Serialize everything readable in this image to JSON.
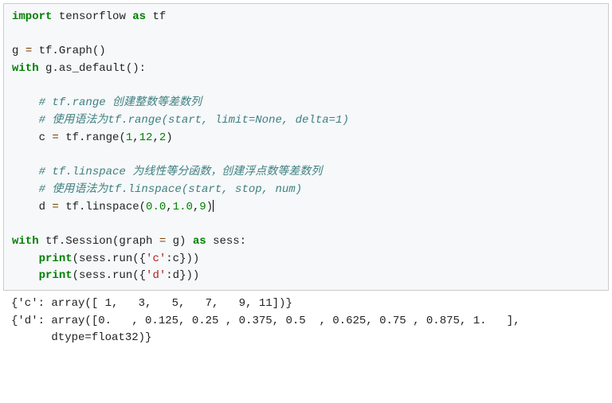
{
  "code": {
    "l1_kw_import": "import",
    "l1_sp1": " ",
    "l1_mod": "tensorflow",
    "l1_sp2": " ",
    "l1_kw_as": "as",
    "l1_sp3": " ",
    "l1_alias": "tf",
    "l2_blank": " ",
    "l3_g": "g ",
    "l3_eq": "=",
    "l3_rest": " tf.Graph()",
    "l4_with": "with",
    "l4_rest": " g.as_default():",
    "l5_blank": " ",
    "l6_indent": "    ",
    "l6_cmt": "# tf.range 创建整数等差数列",
    "l7_indent": "    ",
    "l7_cmt": "# 使用语法为tf.range(start, limit=None, delta=1)",
    "l8_indent": "    ",
    "l8_lhs": "c ",
    "l8_eq": "=",
    "l8_mid": " tf.range(",
    "l8_n1": "1",
    "l8_c1": ",",
    "l8_n2": "12",
    "l8_c2": ",",
    "l8_n3": "2",
    "l8_close": ")",
    "l9_blank": " ",
    "l10_indent": "    ",
    "l10_cmt": "# tf.linspace 为线性等分函数，创建浮点数等差数列",
    "l11_indent": "    ",
    "l11_cmt": "# 使用语法为tf.linspace(start, stop, num)",
    "l12_indent": "    ",
    "l12_lhs": "d ",
    "l12_eq": "=",
    "l12_mid": " tf.linspace(",
    "l12_n1": "0.0",
    "l12_c1": ",",
    "l12_n2": "1.0",
    "l12_c2": ",",
    "l12_n3": "9",
    "l12_close": ")",
    "l13_blank": " ",
    "l14_with": "with",
    "l14_mid1": " tf.Session(graph ",
    "l14_eq": "=",
    "l14_mid2": " g) ",
    "l14_as": "as",
    "l14_mid3": " sess:",
    "l15_indent": "    ",
    "l15_print": "print",
    "l15_open": "(sess.run({",
    "l15_str": "'c'",
    "l15_rest": ":c}))",
    "l16_indent": "    ",
    "l16_print": "print",
    "l16_open": "(sess.run({",
    "l16_str": "'d'",
    "l16_rest": ":d}))"
  },
  "output": {
    "l1": "{'c': array([ 1,   3,   5,   7,   9, 11])}",
    "l2": "{'d': array([0.   , 0.125, 0.25 , 0.375, 0.5  , 0.625, 0.75 , 0.875, 1.   ],",
    "l3": "      dtype=float32)}"
  }
}
